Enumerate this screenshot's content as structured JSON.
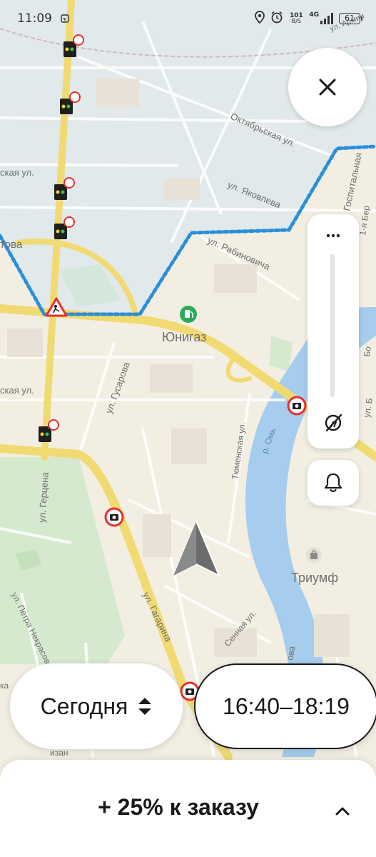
{
  "status_bar": {
    "time": "11:09",
    "net_speed_value": "101",
    "net_speed_unit": "B/S",
    "network": "4G",
    "battery": "61"
  },
  "map": {
    "labels": {
      "oktyabrskaya": "Октябрьская ул.",
      "yakovleva": "ул. Яковлева",
      "rabinovicha": "ул. Рабиновича",
      "gospitalnaya": "Госпитальная",
      "armii": "ул. Армии",
      "skaya_top": "ская ул.",
      "tova": "това",
      "skaya_mid": "ская ул.",
      "gusarova": "ул. Гусарова",
      "tyumenskaya": "Тюменская ул.",
      "r_om": "р. Омь",
      "gertsena": "ул. Герцена",
      "gagarina": "ул. Гагарина",
      "sennaya": "Сенная ул.",
      "petra_nekrasova": "ул. Петра Некрасова",
      "yunigaz": "Юнигаз",
      "triumf": "Триумф",
      "right_b1": "1-я Бер",
      "right_b2": "Бо",
      "right_b3": "ул. Б",
      "ka": "ка",
      "zan": "изан",
      "ova": "ова"
    },
    "poi": {
      "gas_station": "gas-station-icon",
      "shopping": "shopping-bag-icon",
      "navigation_arrow": "navigation-arrow-icon"
    },
    "zone_border_color": "#2a8fd8",
    "river_color": "#a6cdee"
  },
  "controls": {
    "close_icon": "close-icon",
    "more_label": "•••",
    "bell_icon": "bell-icon",
    "traffic_toggle_icon": "traffic-off-icon"
  },
  "schedule": {
    "day_label": "Сегодня",
    "time_range": "16:40–18:19"
  },
  "bottom_sheet": {
    "title": "+ 25% к заказу"
  },
  "colors": {
    "accent": "#1a1a1a",
    "camera_red": "#e6302b",
    "road_yellow": "#f2da73"
  }
}
